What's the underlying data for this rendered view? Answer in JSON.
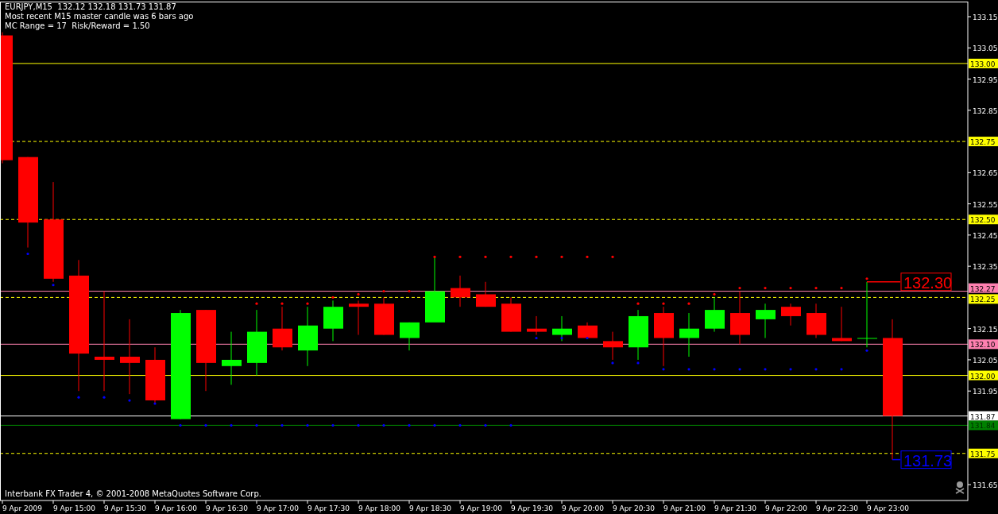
{
  "header": {
    "symbol_line": "EURJPY,M15  132.12 132.18 131.73 131.87",
    "lines": [
      "Most recent M15 master candle was 6 bars ago",
      "MC Range = 17  Risk/Reward = 1.50"
    ]
  },
  "price_axis": [
    "133.15",
    "133.05",
    "132.95",
    "132.85",
    "132.65",
    "132.55",
    "132.45",
    "132.35",
    "132.15",
    "132.05",
    "131.95",
    "131.65"
  ],
  "levels": [
    {
      "label": "133.00",
      "color": "#ffff00"
    },
    {
      "label": "132.75",
      "color": "#ffff00"
    },
    {
      "label": "132.50",
      "color": "#ffff00"
    },
    {
      "label": "132.27",
      "color": "#ff80b0"
    },
    {
      "label": "132.25",
      "color": "#ffff00"
    },
    {
      "label": "132.10",
      "color": "#ff80b0"
    },
    {
      "label": "132.00",
      "color": "#ffff00"
    },
    {
      "label": "131.87",
      "color": "#ffffff"
    },
    {
      "label": "131.84",
      "color": "#008000"
    },
    {
      "label": "131.75",
      "color": "#ffff00"
    }
  ],
  "callouts": [
    {
      "label": "132.30",
      "color": "#ff0000"
    },
    {
      "label": "131.73",
      "color": "#0000ff"
    }
  ],
  "time_axis": [
    "9 Apr 2009",
    "9 Apr 15:00",
    "9 Apr 15:30",
    "9 Apr 16:00",
    "9 Apr 16:30",
    "9 Apr 17:00",
    "9 Apr 17:30",
    "9 Apr 18:00",
    "9 Apr 18:30",
    "9 Apr 19:00",
    "9 Apr 19:30",
    "9 Apr 20:00",
    "9 Apr 20:30",
    "9 Apr 21:00",
    "9 Apr 21:30",
    "9 Apr 22:00",
    "9 Apr 22:30",
    "9 Apr 23:00"
  ],
  "footer": "Interbank FX Trader 4, © 2001-2008 MetaQuotes Software Corp."
}
